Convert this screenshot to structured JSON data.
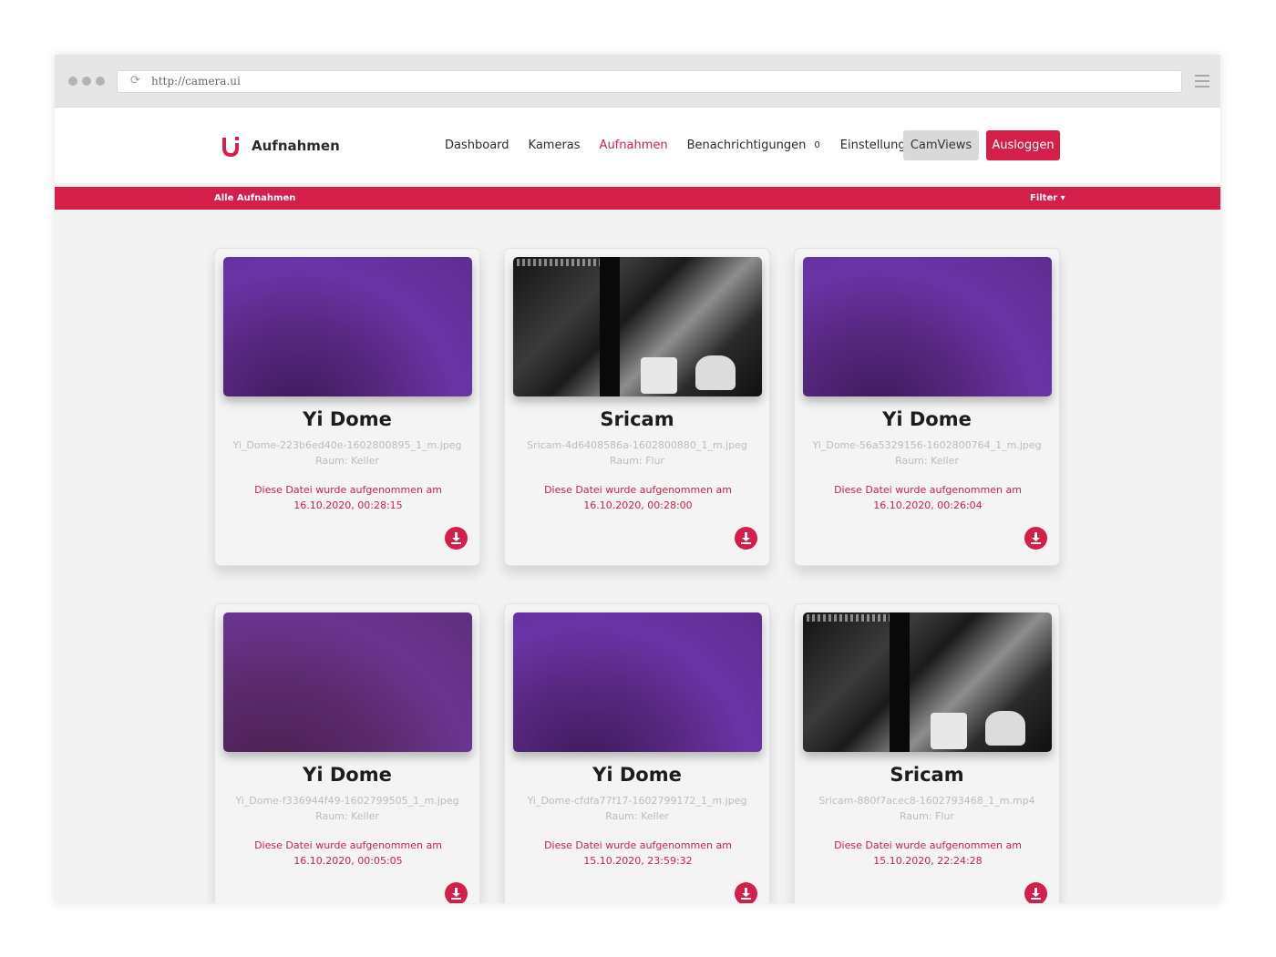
{
  "browser": {
    "url": "http://camera.ui"
  },
  "header": {
    "brand": "Aufnahmen",
    "nav": [
      {
        "label": "Dashboard"
      },
      {
        "label": "Kameras"
      },
      {
        "label": "Aufnahmen"
      },
      {
        "label": "Benachrichtigungen"
      },
      {
        "label": "Einstellungen"
      }
    ],
    "notification_count": "0",
    "camviews_label": "CamViews",
    "logout_label": "Ausloggen"
  },
  "subheader": {
    "left": "Alle Aufnahmen",
    "right": "Filter ▾"
  },
  "colors": {
    "accent": "#d41f4a",
    "background": "#f3f3f3"
  },
  "recordings": [
    {
      "title": "Yi Dome",
      "file": "Yi_Dome-223b6ed40e-1602800895_1_m.jpeg",
      "room": "Raum: Keller",
      "recorded": "Diese Datei wurde aufgenommen am 16.10.2020, 00:28:15",
      "thumb": "purple"
    },
    {
      "title": "Sricam",
      "file": "Sricam-4d6408586a-1602800880_1_m.jpeg",
      "room": "Raum: Flur",
      "recorded": "Diese Datei wurde aufgenommen am 16.10.2020, 00:28:00",
      "thumb": "bw"
    },
    {
      "title": "Yi Dome",
      "file": "Yi_Dome-56a5329156-1602800764_1_m.jpeg",
      "room": "Raum: Keller",
      "recorded": "Diese Datei wurde aufgenommen am 16.10.2020, 00:26:04",
      "thumb": "purple"
    },
    {
      "title": "Yi Dome",
      "file": "Yi_Dome-f336944f49-1602799505_1_m.jpeg",
      "room": "Raum: Keller",
      "recorded": "Diese Datei wurde aufgenommen am 16.10.2020, 00:05:05",
      "thumb": "purple2"
    },
    {
      "title": "Yi Dome",
      "file": "Yi_Dome-cfdfa77f17-1602799172_1_m.jpeg",
      "room": "Raum: Keller",
      "recorded": "Diese Datei wurde aufgenommen am 15.10.2020, 23:59:32",
      "thumb": "purple"
    },
    {
      "title": "Sricam",
      "file": "Sricam-880f7acec8-1602793468_1_m.mp4",
      "room": "Raum: Flur",
      "recorded": "Diese Datei wurde aufgenommen am 15.10.2020, 22:24:28",
      "thumb": "bw"
    }
  ]
}
